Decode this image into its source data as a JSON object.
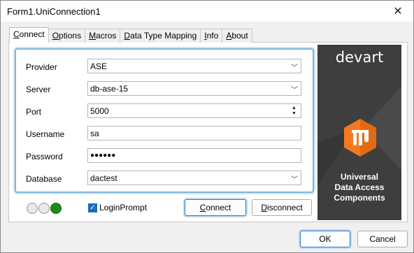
{
  "window": {
    "title": "Form1.UniConnection1"
  },
  "tabs": [
    {
      "label": "Connect",
      "u": "C",
      "rest": "onnect"
    },
    {
      "label": "Options",
      "u": "O",
      "rest": "ptions"
    },
    {
      "label": "Macros",
      "u": "M",
      "rest": "acros"
    },
    {
      "label": "Data Type Mapping",
      "u": "D",
      "rest": "ata Type Mapping"
    },
    {
      "label": "Info",
      "u": "I",
      "rest": "nfo"
    },
    {
      "label": "About",
      "u": "A",
      "rest": "bout"
    }
  ],
  "form": {
    "provider_label": "Provider",
    "provider_value": "ASE",
    "server_label": "Server",
    "server_value": "db-ase-15",
    "port_label": "Port",
    "port_value": "5000",
    "username_label": "Username",
    "username_value": "sa",
    "password_label": "Password",
    "password_value": "●●●●●●",
    "database_label": "Database",
    "database_value": "dactest"
  },
  "status": {
    "leds": [
      "off",
      "off",
      "on"
    ]
  },
  "login_prompt": {
    "label": "LoginPrompt",
    "checked": true
  },
  "buttons": {
    "connect_u": "C",
    "connect_rest": "onnect",
    "disconnect_u": "D",
    "disconnect_rest": "isconnect",
    "ok": "OK",
    "cancel": "Cancel"
  },
  "banner": {
    "brand": "devart",
    "caption_line1": "Universal",
    "caption_line2": "Data Access",
    "caption_line3": "Components",
    "accent_color": "#f47a20"
  }
}
